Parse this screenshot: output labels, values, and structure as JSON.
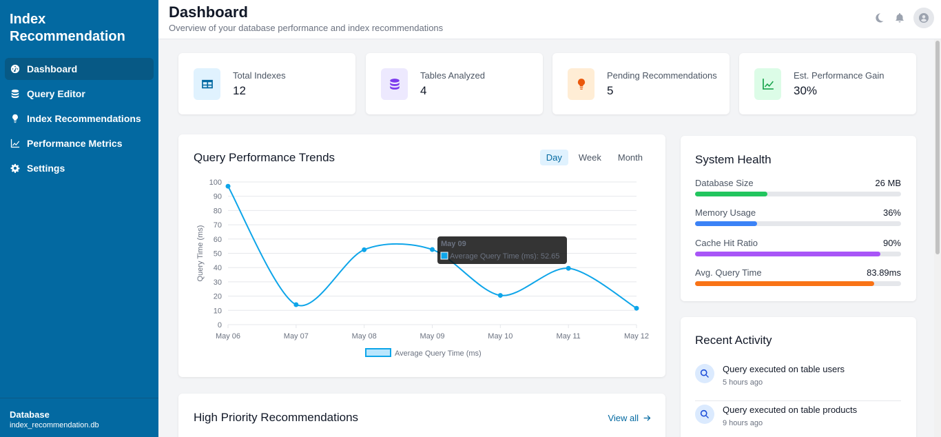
{
  "app": {
    "title": "Index Recommendation"
  },
  "sidebar": {
    "items": [
      {
        "label": "Dashboard",
        "icon": "gauge-icon",
        "active": true
      },
      {
        "label": "Query Editor",
        "icon": "database-icon",
        "active": false
      },
      {
        "label": "Index Recommendations",
        "icon": "lightbulb-icon",
        "active": false
      },
      {
        "label": "Performance Metrics",
        "icon": "chart-line-icon",
        "active": false
      },
      {
        "label": "Settings",
        "icon": "gear-icon",
        "active": false
      }
    ],
    "footer": {
      "title": "Database",
      "value": "index_recommendation.db"
    }
  },
  "header": {
    "title": "Dashboard",
    "subtitle": "Overview of your database performance and index recommendations",
    "icons": [
      "moon-icon",
      "bell-icon",
      "user-avatar-icon"
    ]
  },
  "stats": [
    {
      "label": "Total Indexes",
      "value": "12",
      "icon": "table-icon",
      "bg": "#e0f2fe",
      "color": "#0369a1"
    },
    {
      "label": "Tables Analyzed",
      "value": "4",
      "icon": "database-icon",
      "bg": "#ede9fe",
      "color": "#7c3aed"
    },
    {
      "label": "Pending Recommendations",
      "value": "5",
      "icon": "lightbulb-icon",
      "bg": "#ffedd5",
      "color": "#ea580c"
    },
    {
      "label": "Est. Performance Gain",
      "value": "30%",
      "icon": "chart-line-icon",
      "bg": "#dcfce7",
      "color": "#16a34a"
    }
  ],
  "trends": {
    "title": "Query Performance Trends",
    "tabs": [
      {
        "label": "Day",
        "active": true
      },
      {
        "label": "Week",
        "active": false
      },
      {
        "label": "Month",
        "active": false
      }
    ]
  },
  "chart_data": {
    "type": "line",
    "x": [
      "May 06",
      "May 07",
      "May 08",
      "May 09",
      "May 10",
      "May 11",
      "May 12"
    ],
    "series": [
      {
        "name": "Average Query Time (ms)",
        "values": [
          97,
          14,
          52.5,
          52.65,
          20.5,
          39.5,
          11.5
        ],
        "color": "#0ea5e9"
      }
    ],
    "ylabel": "Query Time (ms)",
    "xlabel": "",
    "ylim": [
      0,
      100
    ],
    "yticks": [
      0,
      10,
      20,
      30,
      40,
      50,
      60,
      70,
      80,
      90,
      100
    ],
    "grid": true,
    "legend": "bottom",
    "tooltip": {
      "title": "May 09",
      "text": "Average Query Time (ms): 52.65"
    }
  },
  "health": {
    "title": "System Health",
    "items": [
      {
        "label": "Database Size",
        "value": "26 MB",
        "percent": 35,
        "color": "#22c55e"
      },
      {
        "label": "Memory Usage",
        "value": "36%",
        "percent": 30,
        "color": "#3b82f6"
      },
      {
        "label": "Cache Hit Ratio",
        "value": "90%",
        "percent": 90,
        "color": "#a855f7"
      },
      {
        "label": "Avg. Query Time",
        "value": "83.89ms",
        "percent": 87,
        "color": "#f97316"
      }
    ]
  },
  "activity": {
    "title": "Recent Activity",
    "items": [
      {
        "text": "Query executed on table users",
        "time": "5 hours ago",
        "icon": "search-icon"
      },
      {
        "text": "Query executed on table products",
        "time": "9 hours ago",
        "icon": "search-icon"
      }
    ]
  },
  "recommendations": {
    "title": "High Priority Recommendations",
    "view_all": "View all"
  }
}
